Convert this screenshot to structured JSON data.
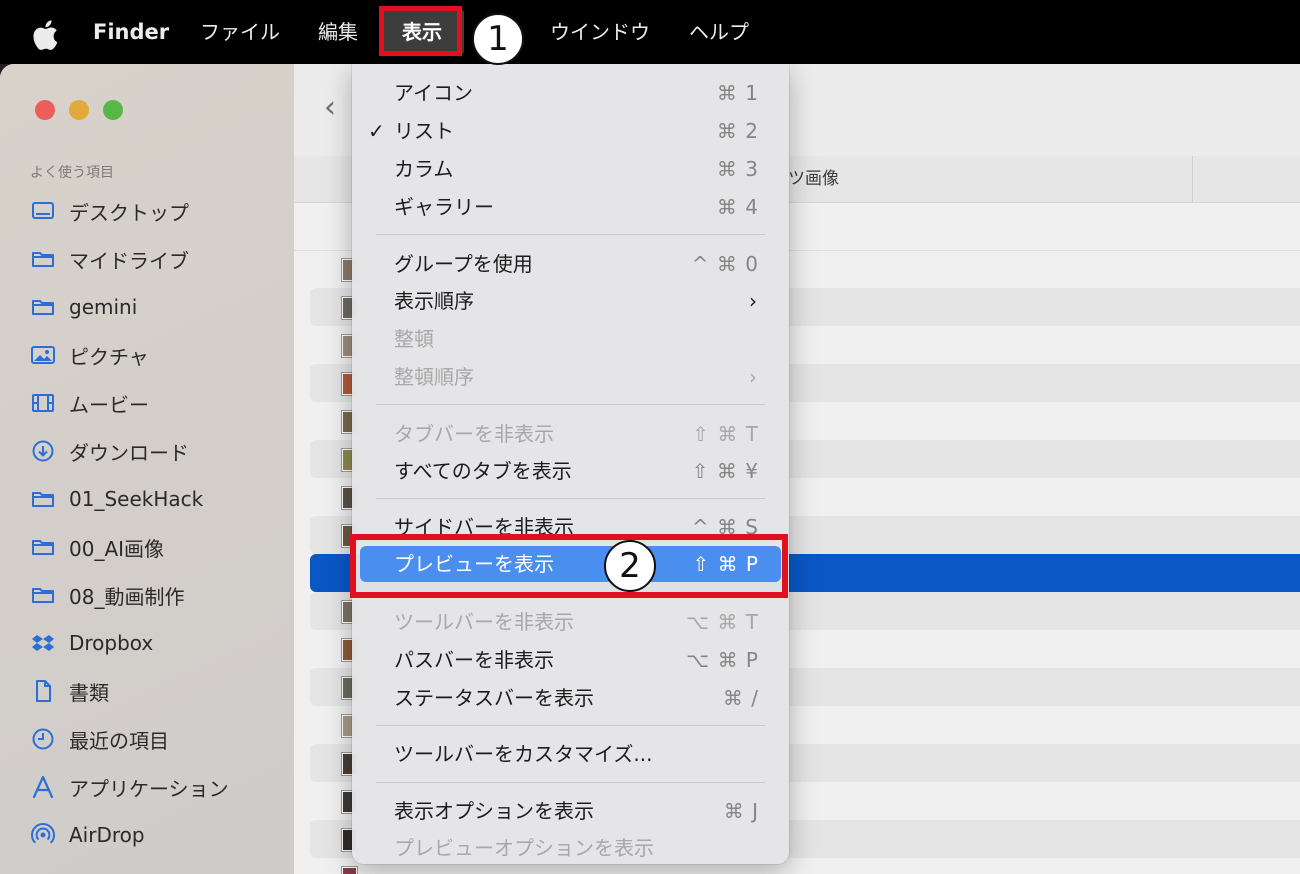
{
  "menubar": {
    "app": "Finder",
    "items": [
      "ファイル",
      "編集",
      "表示",
      "ウインドウ",
      "ヘルプ"
    ]
  },
  "sidebar": {
    "heading": "よく使う項目",
    "items": [
      {
        "label": "デスクトップ",
        "icon": "desktop-icon"
      },
      {
        "label": "マイドライブ",
        "icon": "folder-icon"
      },
      {
        "label": "gemini",
        "icon": "folder-icon"
      },
      {
        "label": "ピクチャ",
        "icon": "pictures-icon"
      },
      {
        "label": "ムービー",
        "icon": "movies-icon"
      },
      {
        "label": "ダウンロード",
        "icon": "download-icon"
      },
      {
        "label": "01_SeekHack",
        "icon": "folder-icon"
      },
      {
        "label": "00_AI画像",
        "icon": "folder-icon"
      },
      {
        "label": "08_動画制作",
        "icon": "folder-icon"
      },
      {
        "label": "Dropbox",
        "icon": "dropbox-icon"
      },
      {
        "label": "書類",
        "icon": "document-icon"
      },
      {
        "label": "最近の項目",
        "icon": "clock-icon"
      },
      {
        "label": "アプリケーション",
        "icon": "applications-icon"
      },
      {
        "label": "AirDrop",
        "icon": "airdrop-icon"
      }
    ]
  },
  "content": {
    "column_header": "ツ画像"
  },
  "view_menu": {
    "items": [
      {
        "label": "アイコン",
        "shortcut": "⌘ 1"
      },
      {
        "label": "リスト",
        "shortcut": "⌘ 2",
        "checked": "✓"
      },
      {
        "label": "カラム",
        "shortcut": "⌘ 3"
      },
      {
        "label": "ギャラリー",
        "shortcut": "⌘ 4"
      },
      {
        "label": "グループを使用",
        "shortcut": "^ ⌘ 0"
      },
      {
        "label": "表示順序",
        "shortcut": "›"
      },
      {
        "label": "整頓",
        "shortcut": ""
      },
      {
        "label": "整頓順序",
        "shortcut": "›"
      },
      {
        "label": "タブバーを非表示",
        "shortcut": "⇧ ⌘ T"
      },
      {
        "label": "すべてのタブを表示",
        "shortcut": "⇧ ⌘ ¥"
      },
      {
        "label": "サイドバーを非表示",
        "shortcut": "^ ⌘ S"
      },
      {
        "label": "プレビューを表示",
        "shortcut": "⇧ ⌘ P"
      },
      {
        "label": "ツールバーを非表示",
        "shortcut": "⌥ ⌘ T"
      },
      {
        "label": "パスバーを非表示",
        "shortcut": "⌥ ⌘ P"
      },
      {
        "label": "ステータスバーを表示",
        "shortcut": "⌘ /"
      },
      {
        "label": "ツールバーをカスタマイズ...",
        "shortcut": ""
      },
      {
        "label": "表示オプションを表示",
        "shortcut": "⌘ J"
      },
      {
        "label": "プレビューオプションを表示",
        "shortcut": ""
      }
    ]
  },
  "annotations": {
    "step1": "1",
    "step2": "2"
  },
  "colors": {
    "highlight": "#4a8ef0",
    "selection": "#0a57c6",
    "annotation_red": "#e0101f"
  }
}
